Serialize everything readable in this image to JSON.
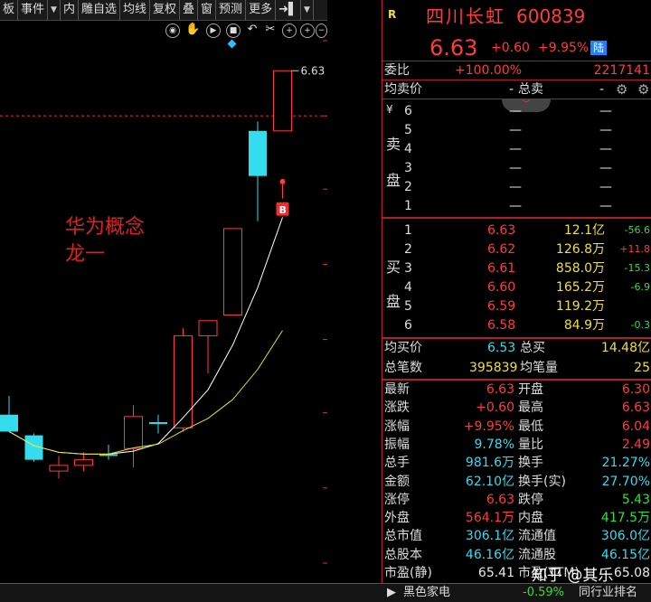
{
  "toolbar": {
    "items": [
      "板",
      "事件",
      "▼",
      "内",
      "雕自选",
      "均线",
      "复权",
      "叠",
      "窗",
      "预测",
      "更多",
      "➜▌",
      "▼"
    ]
  },
  "chart_data": {
    "type": "candlestick",
    "y_ticks": [
      "6.79",
      "6.39",
      "6.00",
      "5.60",
      "5.20",
      "4.81",
      "4.41",
      "4.01"
    ],
    "y_tick_values": [
      6.79,
      6.39,
      6.0,
      5.6,
      5.2,
      4.81,
      4.41,
      4.01
    ],
    "last_price_label": "6.63",
    "buy_marker": "B",
    "annotation_line1": "华为概念",
    "annotation_line2": "龙一",
    "candles": [
      {
        "o": 4.8,
        "h": 4.9,
        "l": 4.71,
        "c": 4.71,
        "color": "cyan"
      },
      {
        "o": 4.69,
        "h": 4.7,
        "l": 4.55,
        "c": 4.56,
        "color": "cyan"
      },
      {
        "o": 4.5,
        "h": 4.58,
        "l": 4.46,
        "c": 4.53,
        "color": "red"
      },
      {
        "o": 4.53,
        "h": 4.6,
        "l": 4.5,
        "c": 4.56,
        "color": "red"
      },
      {
        "o": 4.59,
        "h": 4.64,
        "l": 4.56,
        "c": 4.59,
        "color": "cyan"
      },
      {
        "o": 4.62,
        "h": 4.85,
        "l": 4.52,
        "c": 4.79,
        "color": "red"
      },
      {
        "o": 4.76,
        "h": 4.8,
        "l": 4.7,
        "c": 4.76,
        "color": "cyan"
      },
      {
        "o": 4.73,
        "h": 5.26,
        "l": 4.71,
        "c": 5.22,
        "color": "red"
      },
      {
        "o": 5.22,
        "h": 5.3,
        "l": 5.02,
        "c": 5.3,
        "color": "red"
      },
      {
        "o": 5.33,
        "h": 5.79,
        "l": 5.33,
        "c": 5.79,
        "color": "red"
      },
      {
        "o": 6.07,
        "h": 6.36,
        "l": 5.83,
        "c": 6.31,
        "color": "cyan"
      },
      {
        "o": 6.31,
        "h": 6.63,
        "l": 6.31,
        "c": 6.63,
        "color": "red"
      }
    ]
  },
  "header": {
    "logo": "R",
    "name": "四川长虹",
    "code": "600839",
    "price": "6.63",
    "change": "+0.60",
    "change_pct": "+9.95%",
    "market_tag": "陆"
  },
  "order": {
    "weibi_label": "委比",
    "weibi_val": "+100.00%",
    "weibi_num": "2217141",
    "avg_sell_label": "均卖价",
    "avg_sell_val": "-",
    "total_sell_label": "总卖",
    "total_sell_val": "-"
  },
  "sell": {
    "side_label_top": "卖",
    "side_label_bottom": "盘",
    "yen": "¥",
    "rows": [
      {
        "lvl": "6",
        "p": "—",
        "v": "—"
      },
      {
        "lvl": "5",
        "p": "—",
        "v": "—"
      },
      {
        "lvl": "4",
        "p": "—",
        "v": "—"
      },
      {
        "lvl": "3",
        "p": "—",
        "v": "—"
      },
      {
        "lvl": "2",
        "p": "—",
        "v": "—"
      },
      {
        "lvl": "1",
        "p": "—",
        "v": "—"
      }
    ]
  },
  "buy": {
    "side_label_top": "买",
    "side_label_bottom": "盘",
    "rows": [
      {
        "lvl": "1",
        "p": "6.63",
        "v": "12.1亿",
        "d": "-56.6"
      },
      {
        "lvl": "2",
        "p": "6.62",
        "v": "126.8万",
        "d": "+11.8"
      },
      {
        "lvl": "3",
        "p": "6.61",
        "v": "858.0万",
        "d": "-15.3"
      },
      {
        "lvl": "4",
        "p": "6.60",
        "v": "165.2万",
        "d": "-6.9"
      },
      {
        "lvl": "5",
        "p": "6.59",
        "v": "119.2万",
        "d": ""
      },
      {
        "lvl": "6",
        "p": "6.58",
        "v": "84.9万",
        "d": "-0.3"
      }
    ]
  },
  "summary": {
    "avg_buy_label": "均买价",
    "avg_buy_val": "6.53",
    "total_buy_label": "总买",
    "total_buy_val": "14.48亿",
    "trades_label": "总笔数",
    "trades_val": "395839",
    "avg_trade_label": "均笔量",
    "avg_trade_val": "25"
  },
  "stats": [
    {
      "l1": "最新",
      "v1": "6.63",
      "c1": "red",
      "l2": "开盘",
      "v2": "6.30",
      "c2": "red"
    },
    {
      "l1": "涨跌",
      "v1": "+0.60",
      "c1": "red",
      "l2": "最高",
      "v2": "6.63",
      "c2": "red"
    },
    {
      "l1": "涨幅",
      "v1": "+9.95%",
      "c1": "red",
      "l2": "最低",
      "v2": "6.04",
      "c2": "red"
    },
    {
      "l1": "振幅",
      "v1": "9.78%",
      "c1": "cyan",
      "l2": "量比",
      "v2": "2.49",
      "c2": "red"
    },
    {
      "l1": "总手",
      "v1": "981.6万",
      "c1": "cyan",
      "l2": "换手",
      "v2": "21.27%",
      "c2": "cyan"
    },
    {
      "l1": "金额",
      "v1": "62.10亿",
      "c1": "cyan",
      "l2": "换手(实)",
      "v2": "27.70%",
      "c2": "cyan"
    },
    {
      "l1": "涨停",
      "v1": "6.63",
      "c1": "red",
      "l2": "跌停",
      "v2": "5.43",
      "c2": "green"
    },
    {
      "l1": "外盘",
      "v1": "564.1万",
      "c1": "red",
      "l2": "内盘",
      "v2": "417.5万",
      "c2": "green"
    },
    {
      "l1": "总市值",
      "v1": "306.1亿",
      "c1": "cyan",
      "l2": "流通值",
      "v2": "306.0亿",
      "c2": "cyan"
    },
    {
      "l1": "总股本",
      "v1": "46.16亿",
      "c1": "cyan",
      "l2": "流通股",
      "v2": "46.15亿",
      "c2": "cyan"
    },
    {
      "l1": "市盈(静)",
      "v1": "65.41",
      "c1": "white",
      "l2": "市盈(TTM)",
      "v2": "65.08",
      "c2": "white"
    }
  ],
  "watermark": "知乎 @其乐",
  "bottom": {
    "sector": "黑色家电",
    "sector_pct": "-0.59%",
    "rank": "同行业排名"
  },
  "colors": {
    "up": "#ff3b3b",
    "down": "#33ddee",
    "ma5": "#ffffff",
    "ma10": "#e8e020"
  }
}
